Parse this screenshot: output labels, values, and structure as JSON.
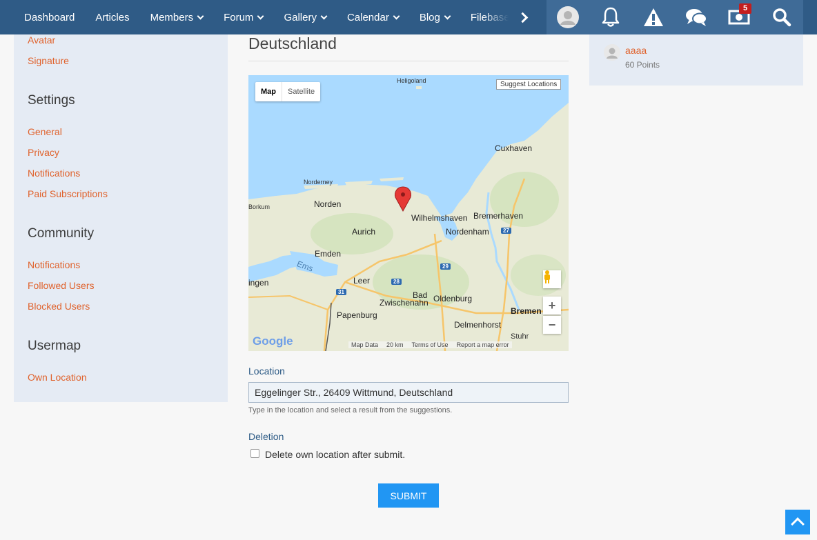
{
  "nav": {
    "items": [
      {
        "label": "Dashboard",
        "dropdown": false
      },
      {
        "label": "Articles",
        "dropdown": false
      },
      {
        "label": "Members",
        "dropdown": true
      },
      {
        "label": "Forum",
        "dropdown": true
      },
      {
        "label": "Gallery",
        "dropdown": true
      },
      {
        "label": "Calendar",
        "dropdown": true
      },
      {
        "label": "Blog",
        "dropdown": true
      },
      {
        "label": "Filebase",
        "dropdown": true
      }
    ],
    "icons": [
      "avatar-icon",
      "bell-icon",
      "warning-icon",
      "chat-icon",
      "money-icon",
      "search-icon"
    ],
    "badge": "5"
  },
  "sidebar": {
    "top_links": [
      "Avatar",
      "Signature"
    ],
    "settings": {
      "heading": "Settings",
      "links": [
        "General",
        "Privacy",
        "Notifications",
        "Paid Subscriptions"
      ]
    },
    "community": {
      "heading": "Community",
      "links": [
        "Notifications",
        "Followed Users",
        "Blocked Users"
      ]
    },
    "usermap": {
      "heading": "Usermap",
      "links": [
        "Own Location"
      ]
    }
  },
  "main": {
    "title": "Deutschland",
    "map": {
      "type_map": "Map",
      "type_satellite": "Satellite",
      "suggest": "Suggest Locations",
      "logo": "Google",
      "footer": [
        "Map Data",
        "20 km",
        "Terms of Use",
        "Report a map error"
      ],
      "cities": [
        "Heligoland",
        "Cuxhaven",
        "Norderney",
        "Borkum",
        "Norden",
        "Wilhelmshaven",
        "Bremerhaven",
        "Aurich",
        "Nordenham",
        "Emden",
        "Ems",
        "Leer",
        "ingen",
        "Bad",
        "Zwischenahn",
        "Oldenburg",
        "Papenburg",
        "Bremen",
        "Delmenhorst",
        "Stuhr"
      ],
      "roads": [
        "27",
        "29",
        "28",
        "31"
      ]
    },
    "location_label": "Location",
    "location_value": "Eggelinger Str., 26409 Wittmund, Deutschland",
    "location_hint": "Type in the location and select a result from the suggestions.",
    "deletion_label": "Deletion",
    "deletion_checkbox": "Delete own location after submit.",
    "submit": "SUBMIT"
  },
  "right": {
    "user_name": "aaaa",
    "user_points": "60 Points"
  },
  "colors": {
    "topbar": "#2f5b86",
    "accent": "#e0622c",
    "primary": "#2196f3",
    "sidebar_bg": "#e5ebf4"
  }
}
